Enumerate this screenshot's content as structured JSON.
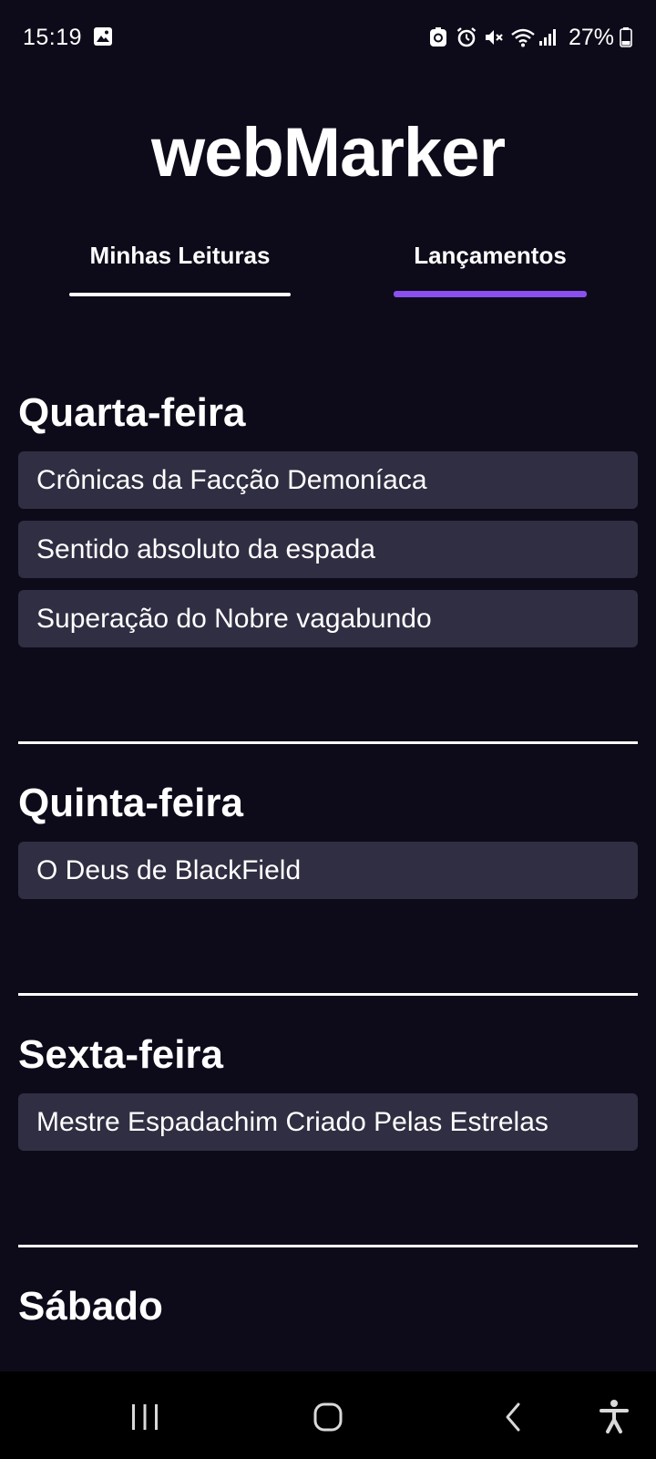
{
  "status_bar": {
    "time": "15:19",
    "battery": "27%"
  },
  "app": {
    "logo": "webMarker"
  },
  "tabs": [
    {
      "label": "Minhas Leituras",
      "active": false
    },
    {
      "label": "Lançamentos",
      "active": true
    }
  ],
  "colors": {
    "background": "#0d0b19",
    "card": "#302e42",
    "accent": "#8b4ff0"
  },
  "sections": [
    {
      "day": "Quarta-feira",
      "items": [
        "Crônicas da Facção Demoníaca",
        "Sentido absoluto da espada",
        "Superação do Nobre vagabundo"
      ]
    },
    {
      "day": "Quinta-feira",
      "items": [
        "O Deus de BlackField"
      ]
    },
    {
      "day": "Sexta-feira",
      "items": [
        "Mestre Espadachim Criado Pelas Estrelas"
      ]
    },
    {
      "day": "Sábado",
      "items": []
    }
  ],
  "nav": {
    "icons": [
      "recent-apps-icon",
      "home-icon",
      "back-icon",
      "accessibility-icon"
    ]
  }
}
